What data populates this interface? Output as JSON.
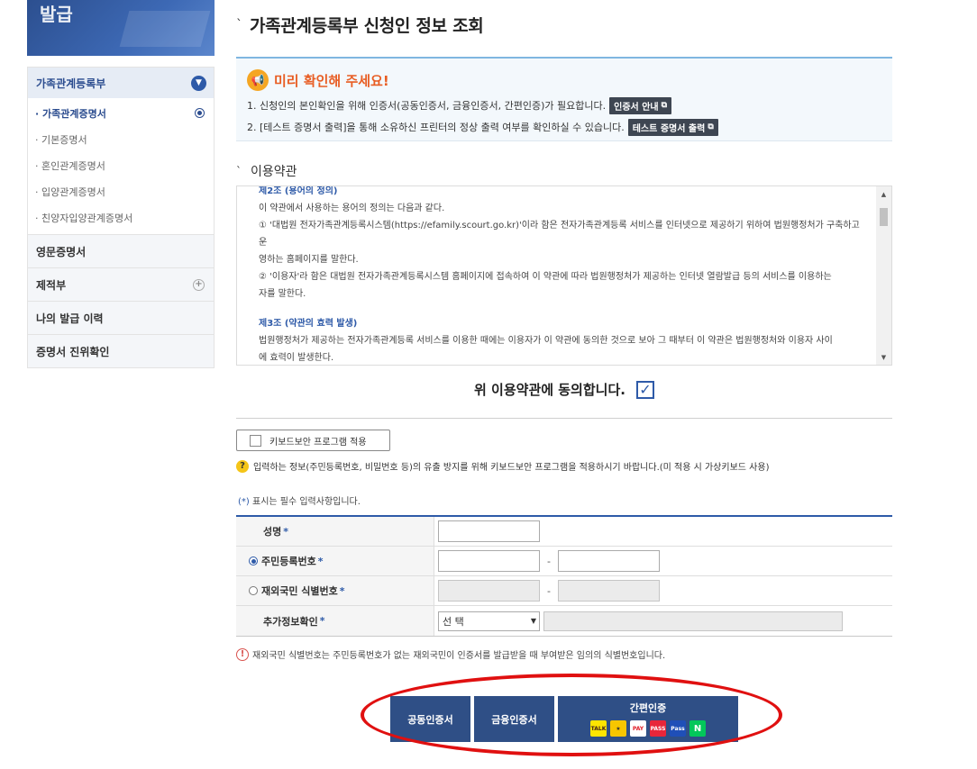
{
  "banner": {
    "text": "발급"
  },
  "sidebar": {
    "sections": [
      {
        "label": "가족관계등록부",
        "icon": "chevron-down-icon"
      },
      {
        "label": "영문증명서"
      },
      {
        "label": "제적부",
        "icon": "plus-icon"
      },
      {
        "label": "나의 발급 이력"
      },
      {
        "label": "증명서 진위확인"
      }
    ],
    "subitems": [
      {
        "label": "· 가족관계증명서"
      },
      {
        "label": "· 기본증명서"
      },
      {
        "label": "· 혼인관계증명서"
      },
      {
        "label": "· 입양관계증명서"
      },
      {
        "label": "· 친양자입양관계증명서"
      }
    ]
  },
  "page": {
    "title": "가족관계등록부 신청인 정보 조회",
    "tick": "ˋ"
  },
  "notice": {
    "title": "미리 확인해 주세요!",
    "line1": "1. 신청인의 본인확인을 위해 인증서(공동인증서, 금융인증서, 간편인증)가 필요합니다.",
    "line1_chip": "인증서 안내",
    "line2": "2. [테스트 증명서 출력]을 통해 소유하신 프린터의 정상 출력 여부를 확인하실 수 있습니다.",
    "line2_chip": "테스트 증명서 출력",
    "ext_icon": "⧉"
  },
  "terms": {
    "heading": "이용약관",
    "lines": [
      "제2조 (용어의 정의)",
      "이 약관에서 사용하는 용어의 정의는 다음과 같다.",
      "① '대법원 전자가족관계등록시스템(https://efamily.scourt.go.kr)'이라 함은 전자가족관계등록 서비스를 인터넷으로 제공하기 위하여 법원행정처가 구축하고 운",
      "영하는 홈페이지를 말한다.",
      "② '이용자'라 함은 대법원 전자가족관계등록시스템 홈페이지에 접속하여 이 약관에 따라 법원행정처가 제공하는 인터넷 열람발급 등의 서비스를 이용하는",
      "자를 말한다.",
      "제3조 (약관의 효력 발생)",
      "법원행정처가 제공하는 전자가족관계등록 서비스를 이용한 때에는 이용자가 이 약관에 동의한 것으로 보아 그 때부터 이 약관은 법원행정처와 이용자 사이",
      "에 효력이 발생한다."
    ]
  },
  "agree": {
    "label": "위 이용약관에 동의합니다.",
    "checked": "✓"
  },
  "keyboard": {
    "button": "키보드보안 프로그램 적용",
    "info": "입력하는 정보(주민등록번호, 비밀번호 등)의 유출 방지를 위해 키보드보안 프로그램을 적용하시기 바랍니다.(미 적용 시 가상키보드 사용)"
  },
  "required_note": {
    "star": "(*)",
    "text": " 표시는 필수 입력사항입니다."
  },
  "form": {
    "name_label": "성명",
    "rrn_label": "주민등록번호",
    "foreign_label": "재외국민 식별번호",
    "extra_label": "추가정보확인",
    "star": "*",
    "dash": "-",
    "select_value": "선 택",
    "select_arrow": "▼"
  },
  "warning": "재외국민 식별번호는 주민등록번호가 없는 재외국민이 인증서를 발급받을 때 부여받은 임의의 식별번호입니다.",
  "buttons": {
    "joint": "공동인증서",
    "financial": "금융인증서",
    "simple": "간편인증",
    "simple_icons": [
      "kakao",
      "toss",
      "payco",
      "PASS",
      "Pass",
      "N"
    ]
  },
  "colors": {
    "accent": "#2e5aa8",
    "button": "#2f4f86",
    "annotation": "#e01010",
    "notice_title": "#e85d23"
  }
}
